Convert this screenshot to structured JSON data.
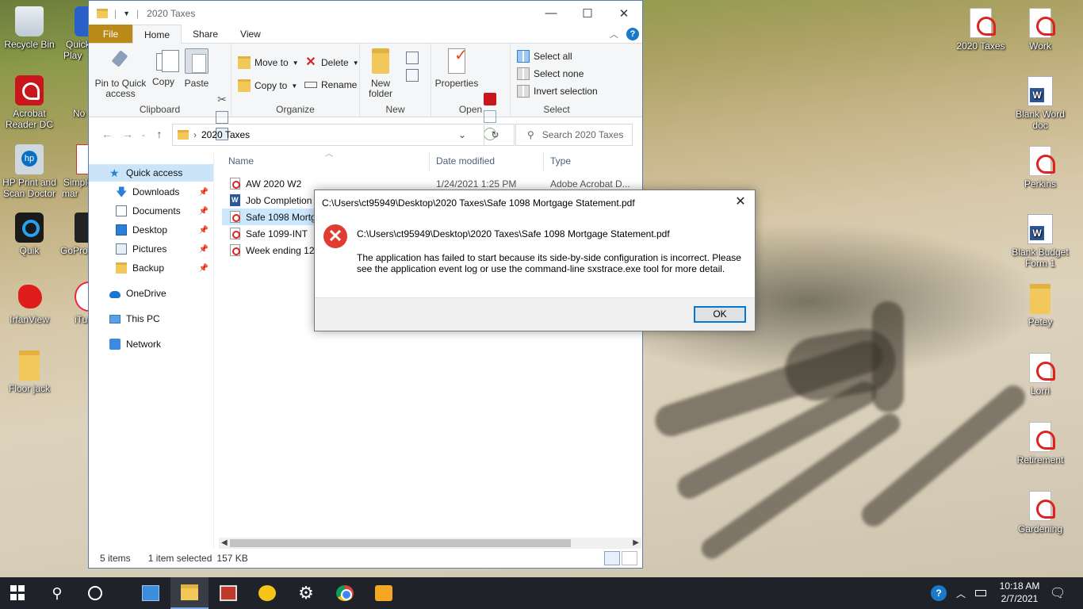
{
  "desktop": {
    "left_icons": [
      {
        "label": "Recycle Bin",
        "icon": "recycle-bin-icon"
      },
      {
        "label": "Quick Play",
        "icon": "quick-play-icon"
      },
      {
        "label": "Acrobat Reader DC",
        "icon": "acrobat-reader-icon"
      },
      {
        "label": "No",
        "icon": "generic-app-icon"
      },
      {
        "label": "HP Print and Scan Doctor",
        "icon": "hp-icon"
      },
      {
        "label": "Simple mar",
        "icon": "simple-app-icon"
      },
      {
        "label": "Quik",
        "icon": "quik-icon"
      },
      {
        "label": "GoPro",
        "icon": "gopro-icon"
      },
      {
        "label": "IrfanView",
        "icon": "irfanview-icon"
      },
      {
        "label": "iTu",
        "icon": "itunes-icon"
      },
      {
        "label": "Floor jack",
        "icon": "folder-icon"
      }
    ],
    "right_icons": [
      {
        "label": "2020 Taxes",
        "icon": "pdf-file-icon"
      },
      {
        "label": "Work",
        "icon": "pdf-file-icon"
      },
      {
        "label": "Blank Word doc",
        "icon": "word-file-icon"
      },
      {
        "label": "Perkins",
        "icon": "pdf-file-icon"
      },
      {
        "label": "Blank Budget Form 1",
        "icon": "word-file-icon"
      },
      {
        "label": "Petey",
        "icon": "folder-icon"
      },
      {
        "label": "Lorri",
        "icon": "pdf-file-icon"
      },
      {
        "label": "Retirement",
        "icon": "pdf-file-icon"
      },
      {
        "label": "Gardening",
        "icon": "pdf-file-icon"
      }
    ]
  },
  "explorer": {
    "title": "2020 Taxes",
    "tabs": {
      "file": "File",
      "home": "Home",
      "share": "Share",
      "view": "View"
    },
    "ribbon": {
      "clipboard": {
        "label": "Clipboard",
        "pin": "Pin to Quick access",
        "copy": "Copy",
        "paste": "Paste"
      },
      "organize": {
        "label": "Organize",
        "move_to": "Move to",
        "copy_to": "Copy to",
        "delete": "Delete",
        "rename": "Rename"
      },
      "new": {
        "label": "New",
        "new_folder": "New folder"
      },
      "open": {
        "label": "Open",
        "properties": "Properties"
      },
      "select": {
        "label": "Select",
        "select_all": "Select all",
        "select_none": "Select none",
        "invert": "Invert selection"
      }
    },
    "address": {
      "path": "2020 Taxes",
      "search_placeholder": "Search 2020 Taxes"
    },
    "nav": {
      "quick_access": "Quick access",
      "items": [
        "Downloads",
        "Documents",
        "Desktop",
        "Pictures",
        "Backup"
      ],
      "onedrive": "OneDrive",
      "this_pc": "This PC",
      "network": "Network"
    },
    "columns": {
      "name": "Name",
      "date": "Date modified",
      "type": "Type"
    },
    "files": [
      {
        "name": "AW 2020 W2",
        "date": "1/24/2021 1:25 PM",
        "type": "Adobe Acrobat D...",
        "kind": "pdf"
      },
      {
        "name": "Job Completion",
        "date": "",
        "type": "",
        "kind": "word"
      },
      {
        "name": "Safe 1098 Mortg",
        "date": "",
        "type": "",
        "kind": "pdf"
      },
      {
        "name": "Safe 1099-INT",
        "date": "",
        "type": "",
        "kind": "pdf"
      },
      {
        "name": "Week ending 12.",
        "date": "",
        "type": "",
        "kind": "pdf"
      }
    ],
    "selected_index": 2,
    "status": {
      "items": "5 items",
      "selected": "1 item selected",
      "size": "157 KB"
    }
  },
  "dialog": {
    "title": "C:\\Users\\ct95949\\Desktop\\2020 Taxes\\Safe 1098 Mortgage Statement.pdf",
    "path": "C:\\Users\\ct95949\\Desktop\\2020 Taxes\\Safe 1098 Mortgage Statement.pdf",
    "message": "The application has failed to start because its side-by-side configuration is incorrect. Please see the application event log or use the command-line sxstrace.exe tool for more detail.",
    "ok": "OK"
  },
  "taskbar": {
    "time": "10:18 AM",
    "date": "2/7/2021"
  }
}
